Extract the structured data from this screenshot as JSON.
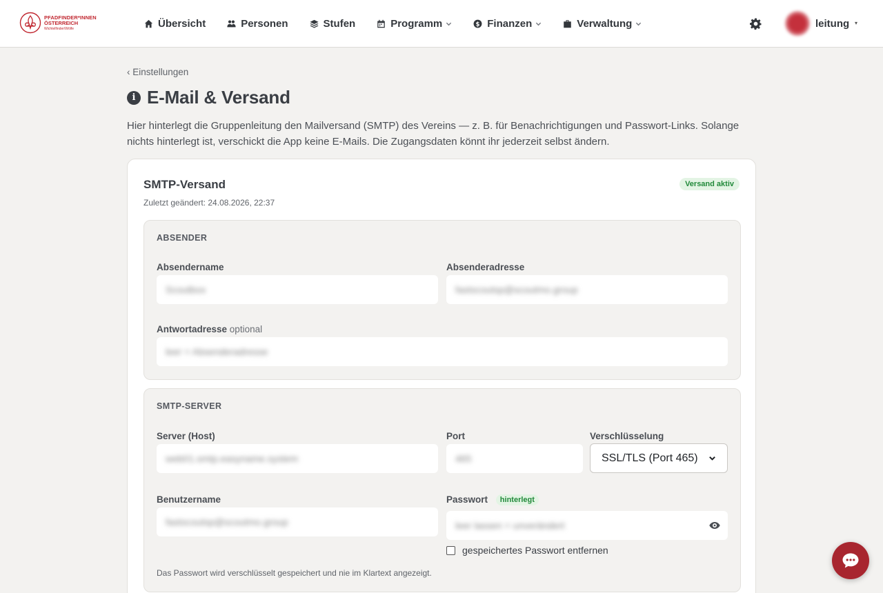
{
  "logo": {
    "line1": "PFADFINDER*INNEN",
    "line2": "ÖSTERREICH",
    "line3": "Wichtelfinder/Wölfe"
  },
  "nav": {
    "items": [
      {
        "label": "Übersicht",
        "icon": "home-icon",
        "dropdown": false
      },
      {
        "label": "Personen",
        "icon": "people-icon",
        "dropdown": false
      },
      {
        "label": "Stufen",
        "icon": "layers-icon",
        "dropdown": false
      },
      {
        "label": "Programm",
        "icon": "calendar-icon",
        "dropdown": true
      },
      {
        "label": "Finanzen",
        "icon": "coin-icon",
        "dropdown": true
      },
      {
        "label": "Verwaltung",
        "icon": "briefcase-icon",
        "dropdown": true
      }
    ],
    "user_name": "leitung",
    "user_caret": "▾"
  },
  "breadcrumb": "‹ Einstellungen",
  "page": {
    "title": "E-Mail & Versand",
    "intro": "Hier hinterlegt die Gruppenleitung den Mailversand (SMTP) des Vereins — z. B. für Benachrichtigungen und Passwort-Links. Solange nichts hinterlegt ist, verschickt die App keine E-Mails. Die Zugangsdaten könnt ihr jederzeit selbst ändern."
  },
  "card": {
    "title": "SMTP-Versand",
    "badge": "Versand aktiv",
    "last_changed": "Zuletzt geändert: 24.08.2026, 22:37"
  },
  "sender": {
    "heading": "ABSENDER",
    "name_label": "Absendername",
    "name_value": "Scoutbox",
    "address_label": "Absenderadresse",
    "address_value": "fastscoutsp@scoutmo.group",
    "reply_label": "Antwortadresse",
    "reply_optional": "optional",
    "reply_placeholder": "leer = Absenderadresse"
  },
  "server": {
    "heading": "SMTP-SERVER",
    "host_label": "Server (Host)",
    "host_value": "web01.smtp.easyname.system",
    "port_label": "Port",
    "port_value": "465",
    "encryption_label": "Verschlüsselung",
    "encryption_value": "SSL/TLS (Port 465)",
    "user_label": "Benutzername",
    "user_value": "fastscoutsp@scoutmo.group",
    "password_label": "Passwort",
    "password_badge": "hinterlegt",
    "password_placeholder": "leer lassen = unverändert",
    "remove_pw_label": "gespeichertes Passwort entfernen",
    "hint": "Das Passwort wird verschlüsselt gespeichert und nie im Klartext angezeigt."
  }
}
